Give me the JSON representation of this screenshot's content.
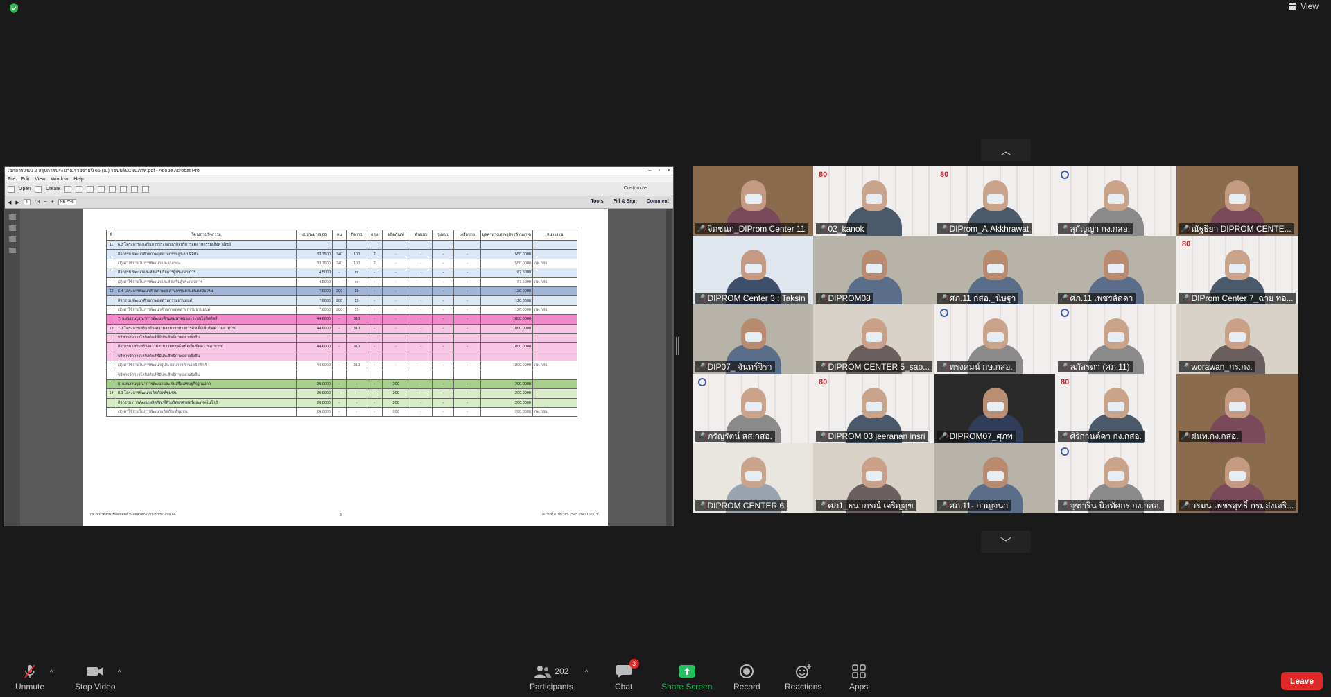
{
  "top": {
    "view_label": "View"
  },
  "acrobat": {
    "title": "เอกสารแนบ 2 สรุปการประมาณรายจ่ายปี 66 (ณ) รอบปรับแผนภาพ.pdf - Adobe Acrobat Pro",
    "menu": [
      "File",
      "Edit",
      "View",
      "Window",
      "Help"
    ],
    "open_label": "Open",
    "create_label": "Create",
    "customize_label": "Customize",
    "page_current": "1",
    "page_total": "/ 3",
    "zoom": "96.5%",
    "tools_label": "Tools",
    "fill_sign_label": "Fill & Sign",
    "comment_label": "Comment"
  },
  "doc": {
    "headers": [
      "ที่",
      "โครงการ/กิจกรรม",
      "งบประมาณ 66",
      "คน",
      "กิจการ",
      "กลุ่ม",
      "ผลิตภัณฑ์",
      "ต้นแบบ",
      "รูปแบบ",
      "เครือข่าย",
      "มูลค่าทางเศรษฐกิจ (ล้านบาท)",
      "หน่วยงาน"
    ],
    "rows": [
      {
        "cls": "r-blue",
        "cells": [
          "11",
          "6.3 โครงการส่งเสริมการประกอบธุรกิจบริการอุตสาหกรรมเชิงพาณิชย์",
          "",
          "",
          "",
          "",
          "",
          "",
          "",
          "",
          "",
          ""
        ]
      },
      {
        "cls": "r-blue",
        "cells": [
          "",
          "กิจกรรม พัฒนาศักยภาพอุตสาหกรรมสู่ระบบดิจิทัล",
          "33.7500",
          "340",
          "100",
          "2",
          "-",
          "-",
          "-",
          "-",
          "550.0000",
          ""
        ]
      },
      {
        "cls": "r-white",
        "cells": [
          "",
          "(1) ค่าใช้จ่ายในการพัฒนาและบ่มเพาะ",
          "33.7500",
          "340",
          "100",
          "2",
          "-",
          "-",
          "-",
          "-",
          "550.0000",
          "กพ.กสอ."
        ]
      },
      {
        "cls": "r-blue",
        "cells": [
          "",
          "กิจกรรม พัฒนาและส่งเสริมกิจการผู้ประกอบการ",
          "4.5000",
          "-",
          "xx",
          "-",
          "-",
          "-",
          "-",
          "-",
          "67.5000",
          ""
        ]
      },
      {
        "cls": "r-white",
        "cells": [
          "",
          "(2) ค่าใช้จ่ายในการพัฒนาและส่งเสริมผู้ประกอบการ",
          "4.5000",
          "-",
          "xx",
          "-",
          "-",
          "-",
          "-",
          "-",
          "67.5000",
          "กพ.กสอ."
        ]
      },
      {
        "cls": "r-sel",
        "cells": [
          "12",
          "6.4 โครงการพัฒนาศักยภาพอุตสาหกรรมยานยนต์สมัยใหม่",
          "7.6000",
          "200",
          "15",
          "-",
          "-",
          "-",
          "-",
          "-",
          "120.0000",
          ""
        ]
      },
      {
        "cls": "r-blue",
        "cells": [
          "",
          "กิจกรรม พัฒนาศักยภาพอุตสาหกรรมยานยนต์",
          "7.6000",
          "200",
          "15",
          "-",
          "-",
          "-",
          "-",
          "-",
          "120.0000",
          ""
        ]
      },
      {
        "cls": "r-white",
        "cells": [
          "",
          "(1) ค่าใช้จ่ายในการพัฒนาศักยภาพอุตสาหกรรมยานยนต์",
          "7.6000",
          "200",
          "15",
          "-",
          "-",
          "-",
          "-",
          "-",
          "120.0000",
          "กพ.กสอ."
        ]
      },
      {
        "cls": "r-pink",
        "cells": [
          "",
          "7. แผนงานบูรณาการพัฒนาด้านคมนาคมและระบบโลจิสติกส์",
          "44.6000",
          "-",
          "310",
          "-",
          "-",
          "-",
          "-",
          "-",
          "1800.0000",
          ""
        ]
      },
      {
        "cls": "r-lpink",
        "cells": [
          "13",
          "7.1 โครงการเสริมสร้างความสามารถทางการค้าเพื่อเพิ่มขีดความสามารถ",
          "44.6000",
          "-",
          "310",
          "-",
          "-",
          "-",
          "-",
          "-",
          "1800.0000",
          ""
        ]
      },
      {
        "cls": "r-lpink",
        "cells": [
          "",
          "บริหารจัดการโลจิสติกส์ที่มีประสิทธิภาพอย่างยั่งยืน",
          "",
          "",
          "",
          "",
          "",
          "",
          "",
          "",
          "",
          ""
        ]
      },
      {
        "cls": "r-lpink",
        "cells": [
          "",
          "กิจกรรม เสริมสร้างความสามารถการค้าเพื่อเพิ่มขีดความสามารถ",
          "44.6000",
          "-",
          "310",
          "-",
          "-",
          "-",
          "-",
          "-",
          "1800.0000",
          ""
        ]
      },
      {
        "cls": "r-lpink",
        "cells": [
          "",
          "บริหารจัดการโลจิสติกส์ที่มีประสิทธิภาพอย่างยั่งยืน",
          "",
          "",
          "",
          "",
          "",
          "",
          "",
          "",
          "",
          ""
        ]
      },
      {
        "cls": "r-white",
        "cells": [
          "",
          "(1) ค่าใช้จ่ายในการพัฒนาผู้ประกอบการด้านโลจิสติกส์",
          "44.6000",
          "-",
          "310",
          "-",
          "-",
          "-",
          "-",
          "-",
          "1800.0000",
          "กพ.กสอ."
        ]
      },
      {
        "cls": "r-white",
        "cells": [
          "",
          "บริหารจัดการโลจิสติกส์ที่มีประสิทธิภาพอย่างยั่งยืน",
          "",
          "",
          "",
          "",
          "",
          "",
          "",
          "",
          "",
          ""
        ]
      },
      {
        "cls": "r-green",
        "cells": [
          "",
          "8. แผนงานบูรณาการพัฒนาและส่งเสริมเศรษฐกิจฐานราก",
          "20.0000",
          "-",
          "-",
          "-",
          "200",
          "-",
          "-",
          "-",
          "200.0000",
          ""
        ]
      },
      {
        "cls": "r-lgreen",
        "cells": [
          "14",
          "8.1 โครงการพัฒนาผลิตภัณฑ์ชุมชน",
          "20.0000",
          "-",
          "-",
          "-",
          "200",
          "-",
          "-",
          "-",
          "200.0000",
          ""
        ]
      },
      {
        "cls": "r-lgreen",
        "cells": [
          "",
          "กิจกรรม การพัฒนาผลิตภัณฑ์ด้วยวิทยาศาสตร์และเทคโนโลยี",
          "20.0000",
          "-",
          "-",
          "-",
          "200",
          "-",
          "-",
          "-",
          "200.0000",
          ""
        ]
      },
      {
        "cls": "r-white",
        "cells": [
          "",
          "(1) ค่าใช้จ่ายในการพัฒนาผลิตภัณฑ์ชุมชน",
          "20.0000",
          "-",
          "-",
          "-",
          "200",
          "-",
          "-",
          "-",
          "200.0000",
          "กพ.กสอ."
        ]
      }
    ],
    "footer_left": "กพ. หน่วยงานรับผิดชอบด้านอุตสาหกรรมปีงบประมาณ 66",
    "footer_center": "3",
    "footer_right": "ณ วันที่ 8 เมษายน 2565 เวลา 15.00 น."
  },
  "participants": [
    {
      "name": "จิตชนก_DIProm Center 11",
      "style": "room"
    },
    {
      "name": "02_kanok",
      "style": "wall80"
    },
    {
      "name": "DIProm_A.Akkhrawat",
      "style": "wall80"
    },
    {
      "name": "สุกัญญา กง.กสอ.",
      "style": "wallL"
    },
    {
      "name": "ณัฐธิยา DIPROM CENTE...",
      "style": "room"
    },
    {
      "name": "DIPROM Center 3 : Taksin",
      "style": "blue"
    },
    {
      "name": "DIPROM08",
      "style": "office"
    },
    {
      "name": "ศภ.11 กสอ._นิษฐา",
      "style": "office"
    },
    {
      "name": "ศภ.11 เพชรลัดดา",
      "style": "office"
    },
    {
      "name": "DIProm Center 7_ฉาย ทอ...",
      "style": "wall80"
    },
    {
      "name": "DIP07_ จันทร์จิรา",
      "style": "office"
    },
    {
      "name": "DIPROM CENTER 5_sao...",
      "style": "plain"
    },
    {
      "name": "ทรงคมน์ กษ.กสอ.",
      "style": "wallL"
    },
    {
      "name": "ลภัสรดา (ศภ.11)",
      "style": "wallL"
    },
    {
      "name": "worawan_กร.กง.",
      "style": "plain"
    },
    {
      "name": "ภรัญรัตน์ สส.กสอ.",
      "style": "wallL"
    },
    {
      "name": "DIPROM 03 jeeranan insri",
      "style": "wall80"
    },
    {
      "name": "DIPROM07_ศุภพ",
      "style": "dark"
    },
    {
      "name": "ศิริกานต์ดา กง.กสอ.",
      "style": "wall80"
    },
    {
      "name": "ฝนท.กง.กสอ.",
      "style": "room"
    },
    {
      "name": "DIPROM CENTER 6",
      "style": "blank"
    },
    {
      "name": "ศภ1_ธนาภรณ์ เจริญสุข",
      "style": "plain"
    },
    {
      "name": "ศภ.11- กาญจนา",
      "style": "office"
    },
    {
      "name": "จุฑาริน นิลทัศกร กง.กสอ.",
      "style": "wallL"
    },
    {
      "name": "วรมน เพชรสุทธิ์ กรมส่งเสริ...",
      "style": "room"
    }
  ],
  "toolbar": {
    "unmute_label": "Unmute",
    "stop_video_label": "Stop Video",
    "participants_label": "Participants",
    "participants_count": "202",
    "chat_label": "Chat",
    "chat_badge": "3",
    "share_label": "Share Screen",
    "record_label": "Record",
    "reactions_label": "Reactions",
    "apps_label": "Apps",
    "leave_label": "Leave"
  },
  "colors": {
    "leave": "#e02828",
    "share": "#21c15b",
    "shield": "#2dbb4f"
  }
}
